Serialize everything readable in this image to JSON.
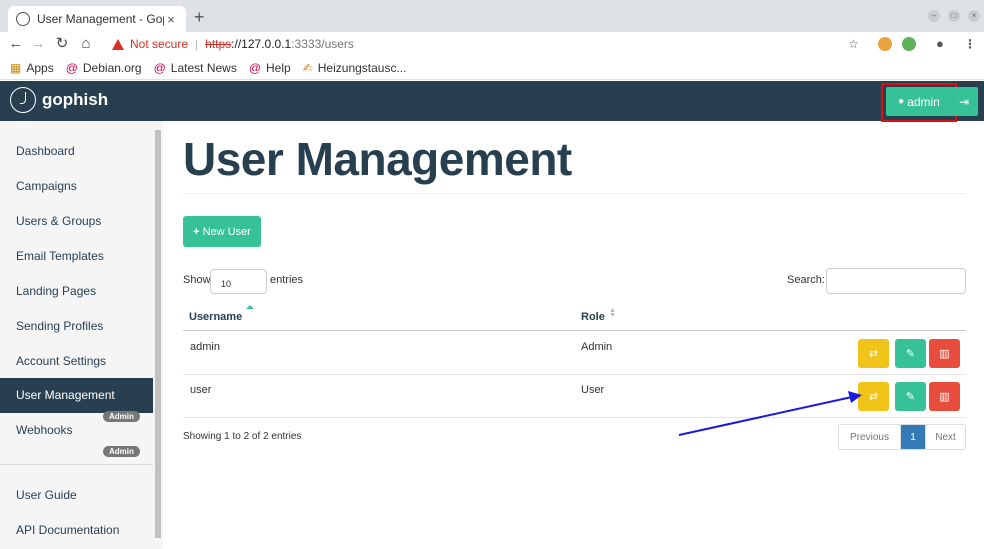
{
  "browser": {
    "tab_title": "User Management - Goph",
    "tab_close": "×",
    "new_tab": "+",
    "not_secure": "Not secure",
    "url_scheme": "https",
    "url_host": "://127.0.0.1",
    "url_path": ":3333/users",
    "bookmarks": [
      {
        "icon": "apps-icon",
        "label": "Apps"
      },
      {
        "icon": "debian-icon",
        "label": "Debian.org"
      },
      {
        "icon": "debian-icon",
        "label": "Latest News"
      },
      {
        "icon": "debian-icon",
        "label": "Help"
      },
      {
        "icon": "link-icon",
        "label": "Heizungstausc..."
      }
    ]
  },
  "navbar": {
    "brand": "gophish",
    "user_button": "admin",
    "accent": "#37c197",
    "bg": "#283f50"
  },
  "sidebar": {
    "items": [
      {
        "label": "Dashboard"
      },
      {
        "label": "Campaigns"
      },
      {
        "label": "Users & Groups"
      },
      {
        "label": "Email Templates"
      },
      {
        "label": "Landing Pages"
      },
      {
        "label": "Sending Profiles"
      },
      {
        "label": "Account Settings"
      },
      {
        "label": "User Management",
        "badge": "Admin"
      },
      {
        "label": "Webhooks",
        "badge": "Admin"
      }
    ],
    "bottom_items": [
      {
        "label": "User Guide"
      },
      {
        "label": "API Documentation"
      }
    ]
  },
  "main": {
    "title": "User Management",
    "new_button": "New User",
    "show_label": "Show",
    "page_length": "10",
    "entries_label": "entries",
    "search_label": "Search:",
    "columns": [
      "Username",
      "Role"
    ],
    "rows": [
      {
        "username": "admin",
        "role": "Admin"
      },
      {
        "username": "user",
        "role": "User"
      }
    ],
    "info": "Showing 1 to 2 of 2 entries",
    "pagination": {
      "prev": "Previous",
      "current": "1",
      "next": "Next"
    }
  }
}
